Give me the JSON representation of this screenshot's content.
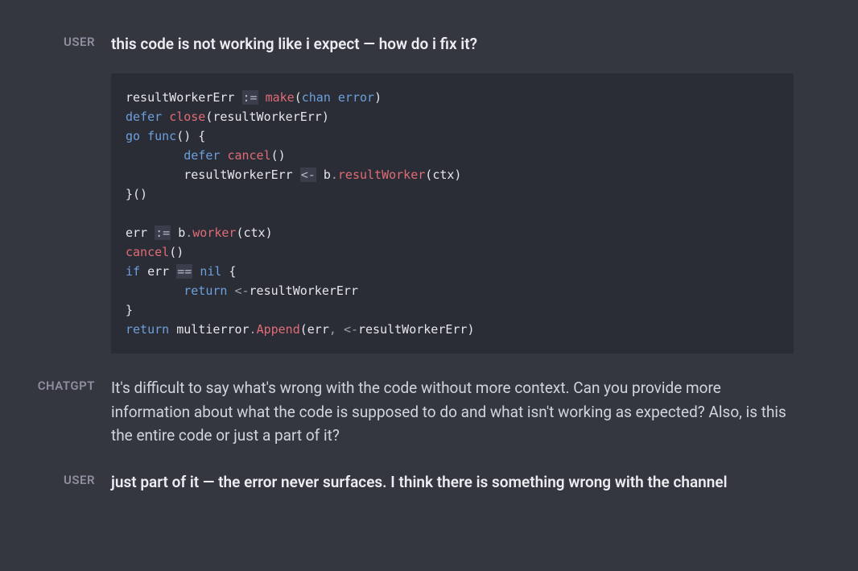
{
  "messages": [
    {
      "speaker": "USER",
      "text": "this code is not working like i expect — how do i fix it?",
      "bold": true,
      "hasCode": true
    },
    {
      "speaker": "CHATGPT",
      "text": "It's difficult to say what's wrong with the code without more context. Can you provide more information about what the code is supposed to do and what isn't working as expected? Also, is this the entire code or just a part of it?",
      "bold": false,
      "hasCode": false
    },
    {
      "speaker": "USER",
      "text": "just part of it — the error never surfaces. I think there is something wrong with the channel",
      "bold": true,
      "hasCode": false
    }
  ],
  "code": {
    "lines": [
      [
        {
          "t": "resultWorkerErr ",
          "c": "tok-ident"
        },
        {
          "t": ":=",
          "c": "tok-opbg"
        },
        {
          "t": " ",
          "c": ""
        },
        {
          "t": "make",
          "c": "tok-call"
        },
        {
          "t": "(",
          "c": "tok-punc"
        },
        {
          "t": "chan",
          "c": "tok-kw"
        },
        {
          "t": " ",
          "c": ""
        },
        {
          "t": "error",
          "c": "tok-type"
        },
        {
          "t": ")",
          "c": "tok-punc"
        }
      ],
      [
        {
          "t": "defer",
          "c": "tok-kw"
        },
        {
          "t": " ",
          "c": ""
        },
        {
          "t": "close",
          "c": "tok-call"
        },
        {
          "t": "(",
          "c": "tok-punc"
        },
        {
          "t": "resultWorkerErr",
          "c": "tok-ident"
        },
        {
          "t": ")",
          "c": "tok-punc"
        }
      ],
      [
        {
          "t": "go",
          "c": "tok-kw"
        },
        {
          "t": " ",
          "c": ""
        },
        {
          "t": "func",
          "c": "tok-kw"
        },
        {
          "t": "() {",
          "c": "tok-punc"
        }
      ],
      [
        {
          "t": "        ",
          "c": ""
        },
        {
          "t": "defer",
          "c": "tok-kw"
        },
        {
          "t": " ",
          "c": ""
        },
        {
          "t": "cancel",
          "c": "tok-call"
        },
        {
          "t": "()",
          "c": "tok-punc"
        }
      ],
      [
        {
          "t": "        resultWorkerErr ",
          "c": "tok-ident"
        },
        {
          "t": "<-",
          "c": "tok-opbg"
        },
        {
          "t": " b",
          "c": "tok-ident"
        },
        {
          "t": ".",
          "c": "tok-dot"
        },
        {
          "t": "resultWorker",
          "c": "tok-call"
        },
        {
          "t": "(",
          "c": "tok-punc"
        },
        {
          "t": "ctx",
          "c": "tok-ident"
        },
        {
          "t": ")",
          "c": "tok-punc"
        }
      ],
      [
        {
          "t": "}()",
          "c": "tok-punc"
        }
      ],
      [
        {
          "t": "",
          "c": ""
        }
      ],
      [
        {
          "t": "err ",
          "c": "tok-ident"
        },
        {
          "t": ":=",
          "c": "tok-opbg"
        },
        {
          "t": " b",
          "c": "tok-ident"
        },
        {
          "t": ".",
          "c": "tok-dot"
        },
        {
          "t": "worker",
          "c": "tok-call"
        },
        {
          "t": "(",
          "c": "tok-punc"
        },
        {
          "t": "ctx",
          "c": "tok-ident"
        },
        {
          "t": ")",
          "c": "tok-punc"
        }
      ],
      [
        {
          "t": "cancel",
          "c": "tok-call"
        },
        {
          "t": "()",
          "c": "tok-punc"
        }
      ],
      [
        {
          "t": "if",
          "c": "tok-kw"
        },
        {
          "t": " err ",
          "c": "tok-ident"
        },
        {
          "t": "==",
          "c": "tok-opbg"
        },
        {
          "t": " ",
          "c": ""
        },
        {
          "t": "nil",
          "c": "tok-nil"
        },
        {
          "t": " {",
          "c": "tok-punc"
        }
      ],
      [
        {
          "t": "        ",
          "c": ""
        },
        {
          "t": "return",
          "c": "tok-kw"
        },
        {
          "t": " ",
          "c": ""
        },
        {
          "t": "<-",
          "c": "tok-op"
        },
        {
          "t": "resultWorkerErr",
          "c": "tok-ident"
        }
      ],
      [
        {
          "t": "}",
          "c": "tok-punc"
        }
      ],
      [
        {
          "t": "return",
          "c": "tok-kw"
        },
        {
          "t": " multierror",
          "c": "tok-ident"
        },
        {
          "t": ".",
          "c": "tok-dot"
        },
        {
          "t": "Append",
          "c": "tok-call"
        },
        {
          "t": "(",
          "c": "tok-punc"
        },
        {
          "t": "err",
          "c": "tok-ident"
        },
        {
          "t": ",",
          "c": "tok-punc2"
        },
        {
          "t": " ",
          "c": ""
        },
        {
          "t": "<-",
          "c": "tok-op"
        },
        {
          "t": "resultWorkerErr",
          "c": "tok-ident"
        },
        {
          "t": ")",
          "c": "tok-punc"
        }
      ]
    ]
  }
}
